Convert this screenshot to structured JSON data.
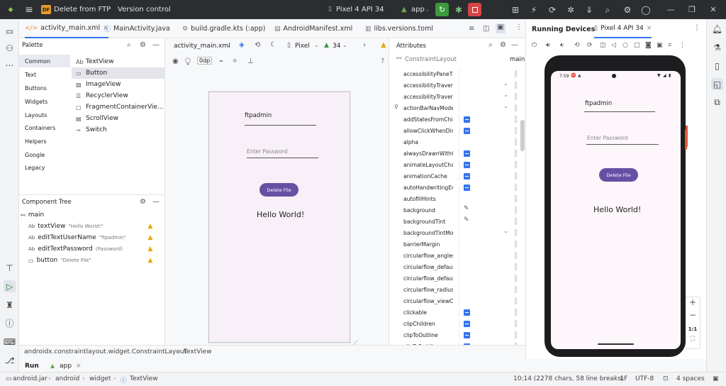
{
  "titlebar": {
    "project_badge": "DF",
    "project_name": "Delete from FTP",
    "vcs": "Version control",
    "device": "Pixel 4 API 34",
    "run_config": "app"
  },
  "editor_tabs": [
    "activity_main.xml",
    "MainActivity.java",
    "build.gradle.kts (:app)",
    "AndroidManifest.xml",
    "libs.versions.toml"
  ],
  "palette": {
    "title": "Palette",
    "categories": [
      "Common",
      "Text",
      "Buttons",
      "Widgets",
      "Layouts",
      "Containers",
      "Helpers",
      "Google",
      "Legacy"
    ],
    "items": [
      "TextView",
      "Button",
      "ImageView",
      "RecyclerView",
      "FragmentContainerVie...",
      "ScrollView",
      "Switch"
    ],
    "item_prefix_text": "Ab"
  },
  "component_tree": {
    "title": "Component Tree",
    "root": "main",
    "items": [
      {
        "prefix": "Ab",
        "name": "textView",
        "sub": "\"Hello World!\""
      },
      {
        "prefix": "Ab",
        "name": "editTextUserName",
        "sub": "\"ftpadmin\""
      },
      {
        "prefix": "Ab",
        "name": "editTextPassword",
        "sub": "(Password)"
      },
      {
        "prefix": "",
        "name": "button",
        "sub": "\"Delete File\""
      }
    ]
  },
  "designer": {
    "file": "activity_main.xml",
    "device": "Pixel",
    "api": "34",
    "margin": "0dp",
    "username_text": "ftpadmin",
    "password_hint": "Enter Password",
    "button_text": "Delete File",
    "hello_text": "Hello World!"
  },
  "attributes": {
    "title": "Attributes",
    "layout": "ConstraintLayout",
    "id": "main",
    "rows": [
      "accessibilityPaneTitle",
      "accessibilityTravers...",
      "accessibilityTravers...",
      "actionBarNavMode",
      "addStatesFromChild...",
      "allowClickWhenDisa...",
      "alpha",
      "alwaysDrawnWithCa...",
      "animateLayoutChan...",
      "animationCache",
      "autoHandwritingEna...",
      "autofillHints",
      "background",
      "backgroundTint",
      "backgroundTintMode",
      "barrierMargin",
      "circularflow_angles",
      "circularflow_defaultA...",
      "circularflow_defaultR...",
      "circularflow_radiusIn...",
      "circularflow_viewCen...",
      "clickable",
      "clipChildren",
      "clipToOutline",
      "clipToPadding"
    ]
  },
  "running_devices": {
    "title": "Running Devices",
    "tab": "Pixel 4 API 34",
    "status_time": "7:59",
    "username_text": "ftpadmin",
    "password_hint": "Enter Password",
    "button_text": "Delete File",
    "hello_text": "Hello World!",
    "zoom_label": "1:1"
  },
  "breadcrumb": [
    "androidx.constraintlayout.widget.ConstraintLayout",
    "TextView"
  ],
  "runbar": {
    "run": "Run",
    "app": "app"
  },
  "statusbar": {
    "path": [
      "android.jar",
      "android",
      "widget",
      "TextView"
    ],
    "position": "10:14 (2278 chars, 58 line breaks)",
    "line_sep": "LF",
    "encoding": "UTF-8",
    "indent": "4 spaces"
  },
  "colors": {
    "accent": "#3574f0",
    "run_green": "#3b9a3b",
    "stop_red": "#d64545",
    "button_purple": "#6750a4",
    "warning": "#e6a700"
  }
}
